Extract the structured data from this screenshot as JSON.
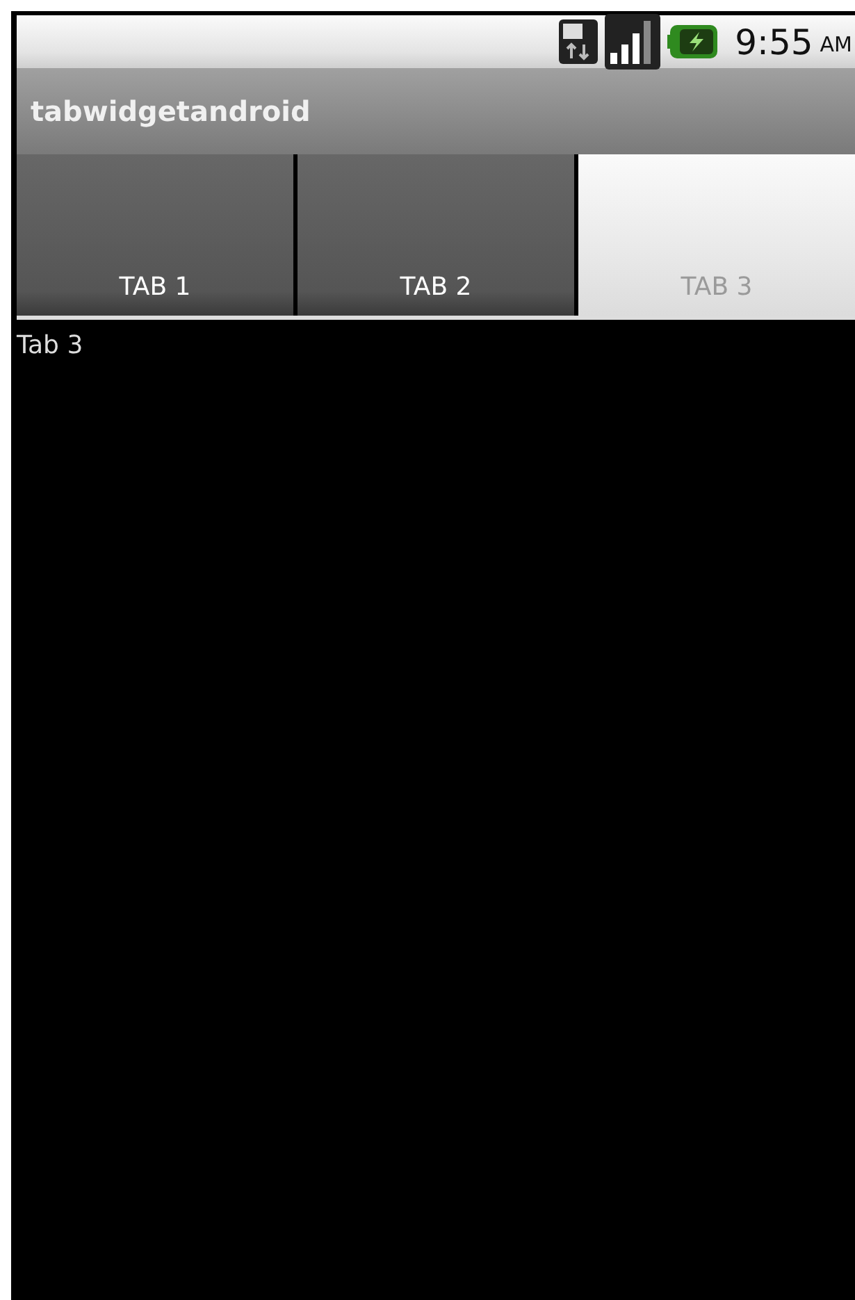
{
  "status_bar": {
    "time": "9:55",
    "time_suffix": "AM"
  },
  "title_bar": {
    "title": "tabwidgetandroid"
  },
  "tabs": [
    {
      "label": "TAB 1",
      "selected": false
    },
    {
      "label": "TAB 2",
      "selected": false
    },
    {
      "label": "TAB 3",
      "selected": true
    }
  ],
  "content": {
    "text": "Tab 3"
  }
}
